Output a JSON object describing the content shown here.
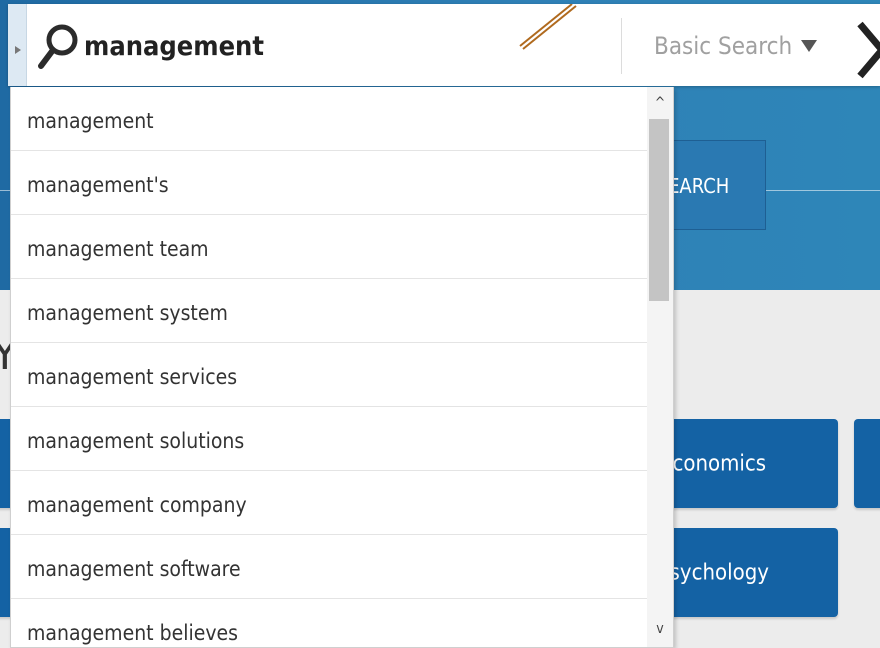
{
  "search": {
    "query": "management",
    "mode_label": "Basic Search",
    "mode_caret": "▼",
    "next_chevron": "❯"
  },
  "hero": {
    "search_button_label": "SEARCH"
  },
  "section_heading_partial": "Y",
  "categories": [
    {
      "label": "Economics"
    },
    {
      "label": "Psychology"
    }
  ],
  "autocomplete": {
    "suggestions": [
      "management",
      "management's",
      "management team",
      "management system",
      "management services",
      "management solutions",
      "management company",
      "management software",
      "management believes"
    ],
    "scroll_up": "^",
    "scroll_down": "v"
  },
  "colors": {
    "hero_blue": "#2f80b6",
    "tile_blue": "#1462a4",
    "dropdown_bg": "#ffffff"
  }
}
